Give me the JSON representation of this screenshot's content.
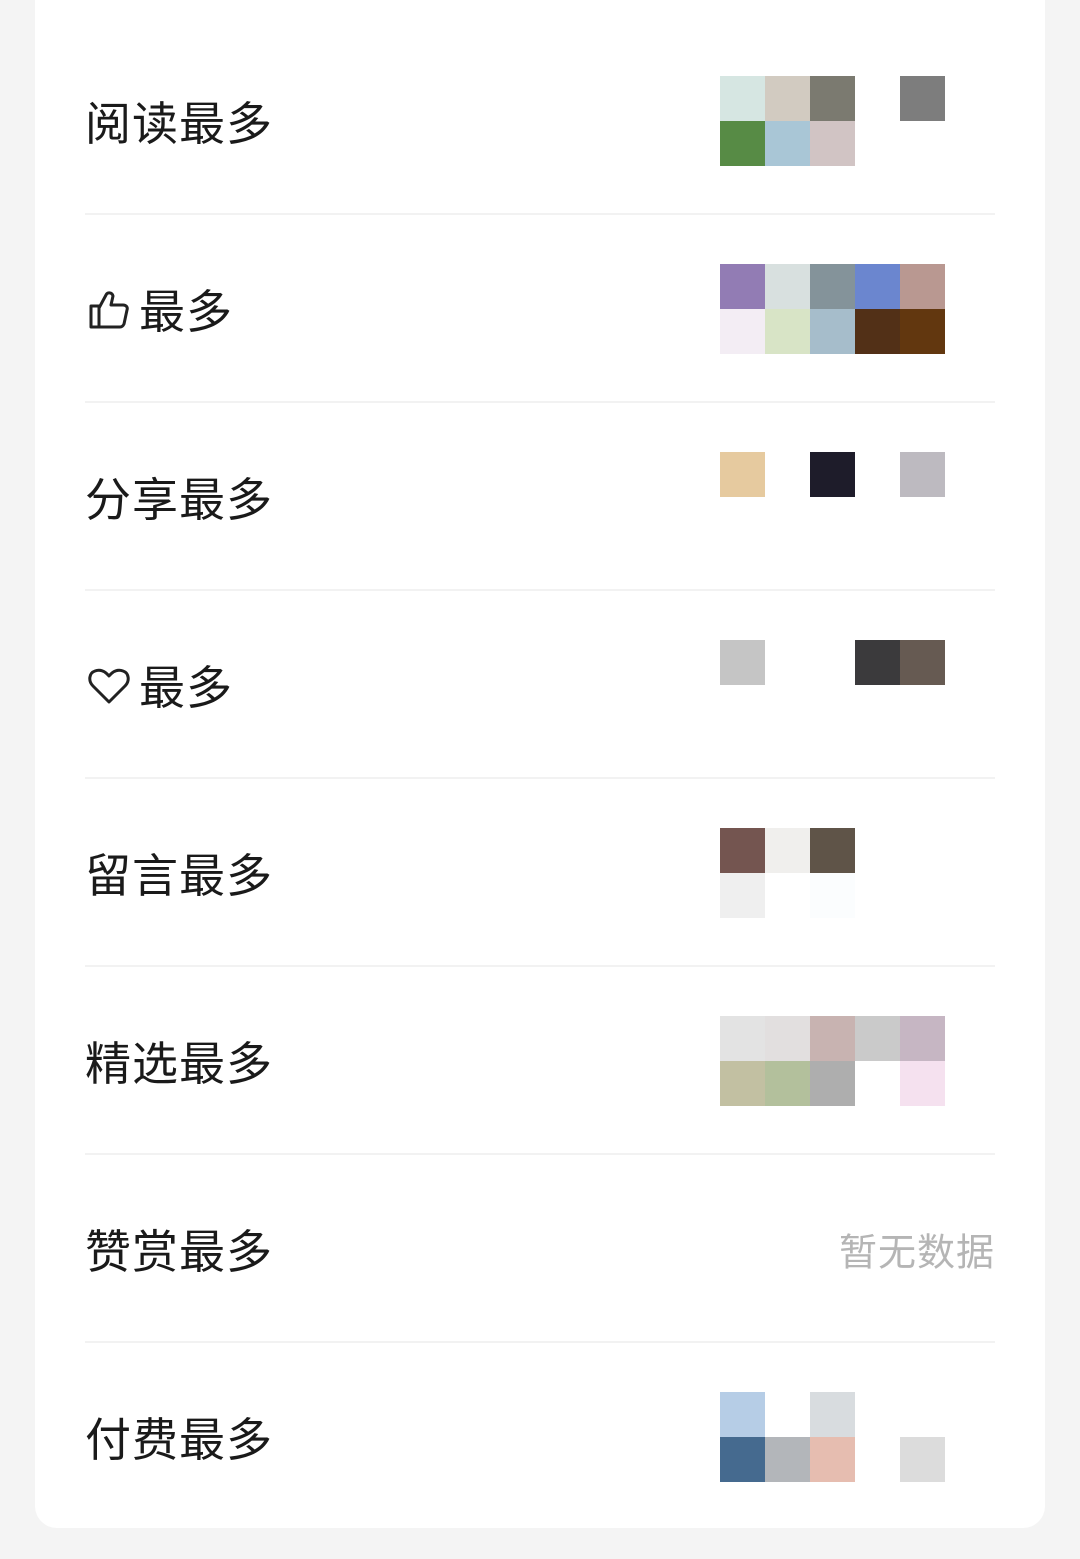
{
  "colors": {
    "background": "#f4f4f4",
    "card": "#ffffff",
    "text": "#1a1a1a",
    "muted": "#b5b5b5"
  },
  "rows": [
    {
      "label": "阅读最多",
      "icon": "",
      "mosaic": [
        [
          "#d6e6e2",
          "#d2cbc1",
          "#7b7a70",
          null,
          "#7d7d7d"
        ],
        [
          "#578b45",
          "#a9c6d6",
          "#d1c4c4",
          null,
          null
        ]
      ]
    },
    {
      "label": "最多",
      "icon": "thumbs-up-icon",
      "mosaic": [
        [
          "#927cb4",
          "#d8e0df",
          "#84939a",
          "#6b86cf",
          "#b99891"
        ],
        [
          "#f3edf4",
          "#d8e4c6",
          "#a6bdcb",
          "#523017",
          "#62370f"
        ]
      ]
    },
    {
      "label": "分享最多",
      "icon": "",
      "mosaic": [
        [
          "#e6ca9f",
          null,
          "#1e1c2a",
          null,
          "#bdbac0"
        ],
        [
          null,
          null,
          null,
          null,
          null
        ]
      ]
    },
    {
      "label": "最多",
      "icon": "heart-icon",
      "mosaic": [
        [
          "#c5c5c5",
          null,
          null,
          "#3b3a3c",
          "#665a52"
        ],
        [
          null,
          null,
          null,
          null,
          null
        ]
      ]
    },
    {
      "label": "留言最多",
      "icon": "",
      "mosaic": [
        [
          "#745550",
          "#f0efed",
          "#5f5448",
          null,
          null
        ],
        [
          "#efefef",
          null,
          "#fbfdfe",
          null,
          null
        ]
      ]
    },
    {
      "label": "精选最多",
      "icon": "",
      "mosaic": [
        [
          "#e3e3e3",
          "#e2dfdf",
          "#c8b3b1",
          "#cacaca",
          "#c6b6c3"
        ],
        [
          "#c2c0a2",
          "#b3c09c",
          "#aeaeae",
          null,
          "#f5e1ef"
        ]
      ]
    },
    {
      "label": "赞赏最多",
      "icon": "",
      "no_data": "暂无数据"
    },
    {
      "label": "付费最多",
      "icon": "",
      "mosaic": [
        [
          "#b6cde6",
          null,
          "#d8dcdf",
          null,
          null
        ],
        [
          "#456a8f",
          "#b3b6ba",
          "#e6bdb0",
          null,
          "#dcdcdc"
        ]
      ]
    }
  ]
}
